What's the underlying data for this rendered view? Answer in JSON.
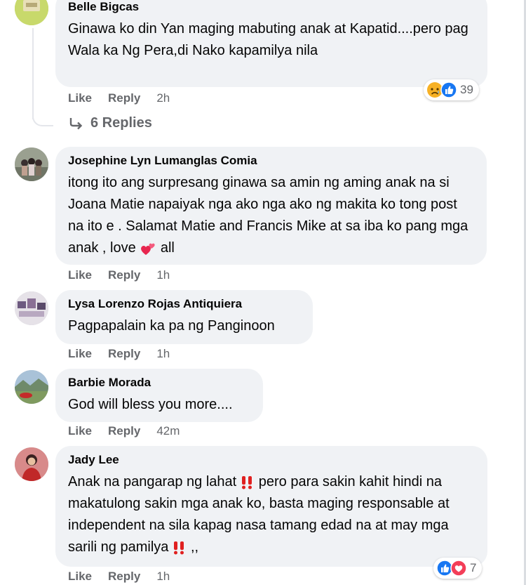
{
  "comments": [
    {
      "author": "Belle Bigcas",
      "text": "Ginawa ko din Yan maging mabuting anak at Kapatid....pero pag Wala ka Ng Pera,di Nako kapamilya nila",
      "like_label": "Like",
      "reply_label": "Reply",
      "time": "2h",
      "reaction_count": "39",
      "reaction_icons": [
        "sad-icon",
        "like-icon"
      ],
      "replies_label": "6 Replies"
    },
    {
      "author": "Josephine Lyn Lumanglas Comia",
      "text_parts": [
        "itong ito ang surpresang ginawa sa amin ng aming anak na si Joana Matie napaiyak nga ako nga ako ng makita ko tong post na ito e . Salamat Matie and Francis Mike at sa iba ko pang mga anak , love ",
        " all"
      ],
      "inline_emoji": "two-hearts-icon",
      "like_label": "Like",
      "reply_label": "Reply",
      "time": "1h"
    },
    {
      "author": "Lysa Lorenzo Rojas Antiquiera",
      "text": "Pagpapalain ka pa ng Panginoon",
      "like_label": "Like",
      "reply_label": "Reply",
      "time": "1h"
    },
    {
      "author": "Barbie Morada",
      "text": "God will bless you more....",
      "like_label": "Like",
      "reply_label": "Reply",
      "time": "42m"
    },
    {
      "author": "Jady Lee",
      "text_parts": [
        "Anak na pangarap ng lahat",
        " pero para sakin kahit hindi na makatulong sakin mga anak ko, basta maging responsable at independent na sila kapag nasa tamang edad na at may mga sarili ng pamilya",
        " ,,"
      ],
      "inline_emoji": "double-exclamation-icon",
      "like_label": "Like",
      "reply_label": "Reply",
      "time": "1h",
      "reaction_count": "7",
      "reaction_icons": [
        "like-icon",
        "love-icon"
      ]
    }
  ],
  "colors": {
    "bubble": "#f0f2f5",
    "meta_text": "#65676b",
    "like_blue": "#1877f2",
    "love_red": "#f33e58",
    "sad_yellow": "#f7b125"
  }
}
